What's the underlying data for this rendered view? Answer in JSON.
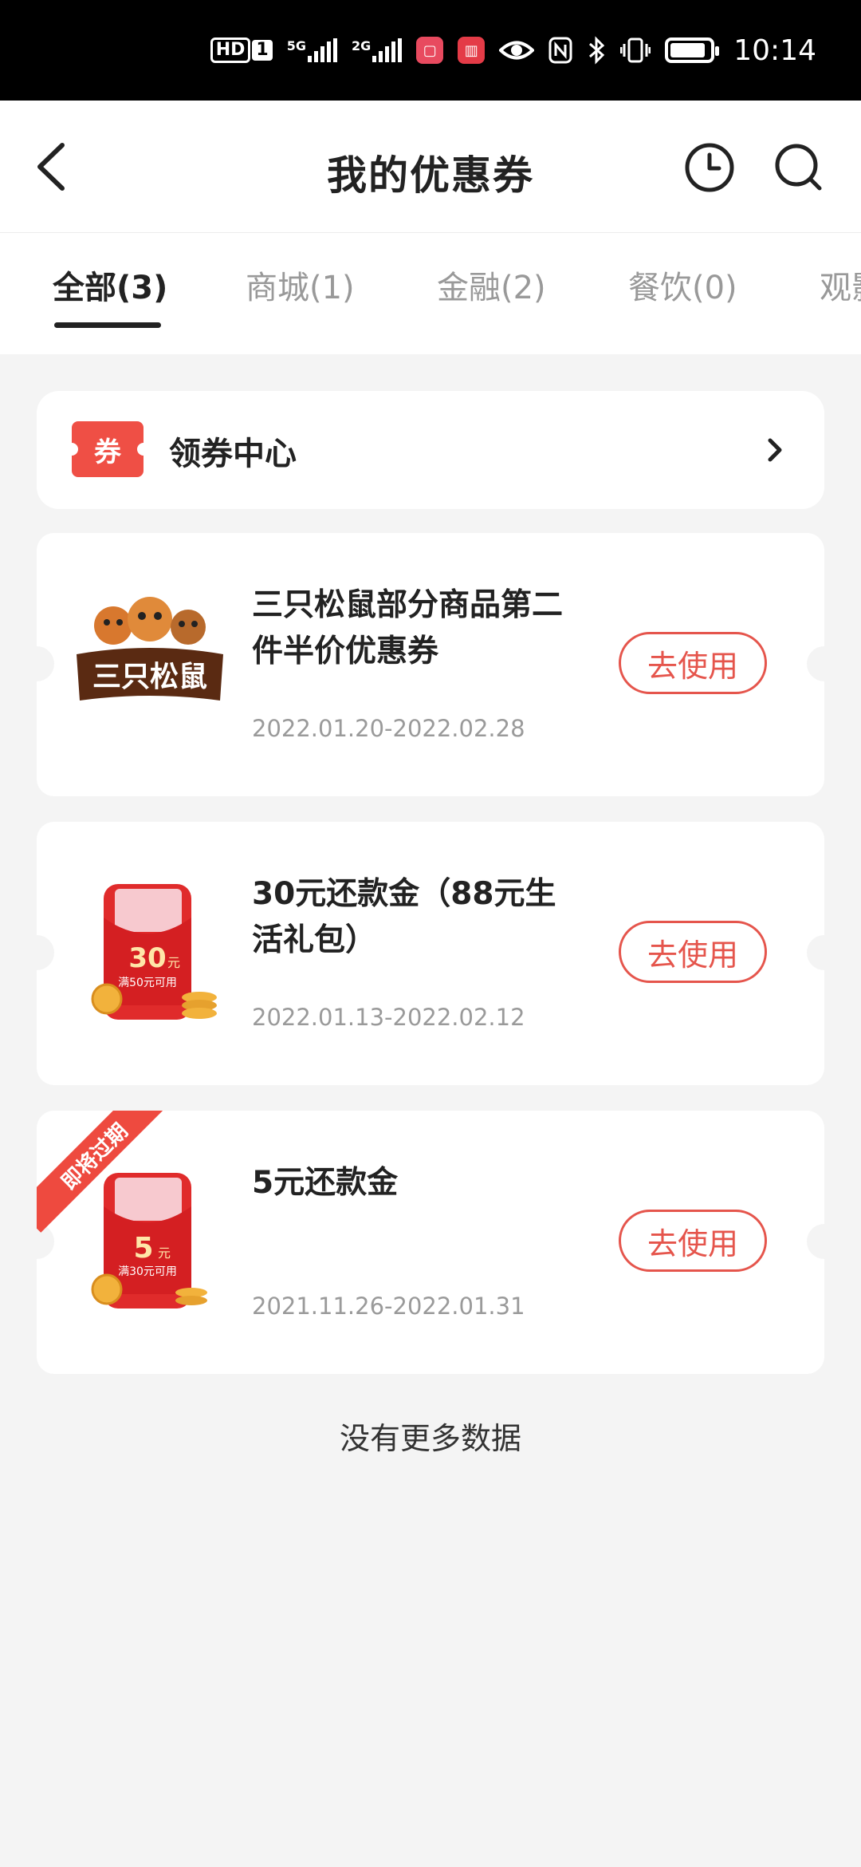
{
  "status_bar": {
    "hd": "HD",
    "hd_sub": "1",
    "net_5g": "5G",
    "net_2g": "2G",
    "time": "10:14"
  },
  "header": {
    "title": "我的优惠券"
  },
  "tabs": [
    {
      "label": "全部(3)"
    },
    {
      "label": "商城(1)"
    },
    {
      "label": "金融(2)"
    },
    {
      "label": "餐饮(0)"
    },
    {
      "label": "观影"
    }
  ],
  "coupon_center": {
    "badge": "券",
    "label": "领券中心"
  },
  "coupons": [
    {
      "title": "三只松鼠部分商品第二件半价优惠券",
      "date": "2022.01.20-2022.02.28",
      "button": "去使用",
      "logo_text": "三只松鼠"
    },
    {
      "title": "30元还款金（88元生活礼包）",
      "date": "2022.01.13-2022.02.12",
      "button": "去使用",
      "amount": "30",
      "unit": "元",
      "condition": "满50元可用"
    },
    {
      "title": "5元还款金",
      "date": "2021.11.26-2022.01.31",
      "button": "去使用",
      "amount": "5",
      "unit": "元",
      "condition": "满30元可用",
      "ribbon": "即将过期"
    }
  ],
  "footer": {
    "no_more": "没有更多数据"
  },
  "colors": {
    "accent": "#e5554c",
    "badge_red": "#ef4f45",
    "background": "#f4f4f4"
  }
}
